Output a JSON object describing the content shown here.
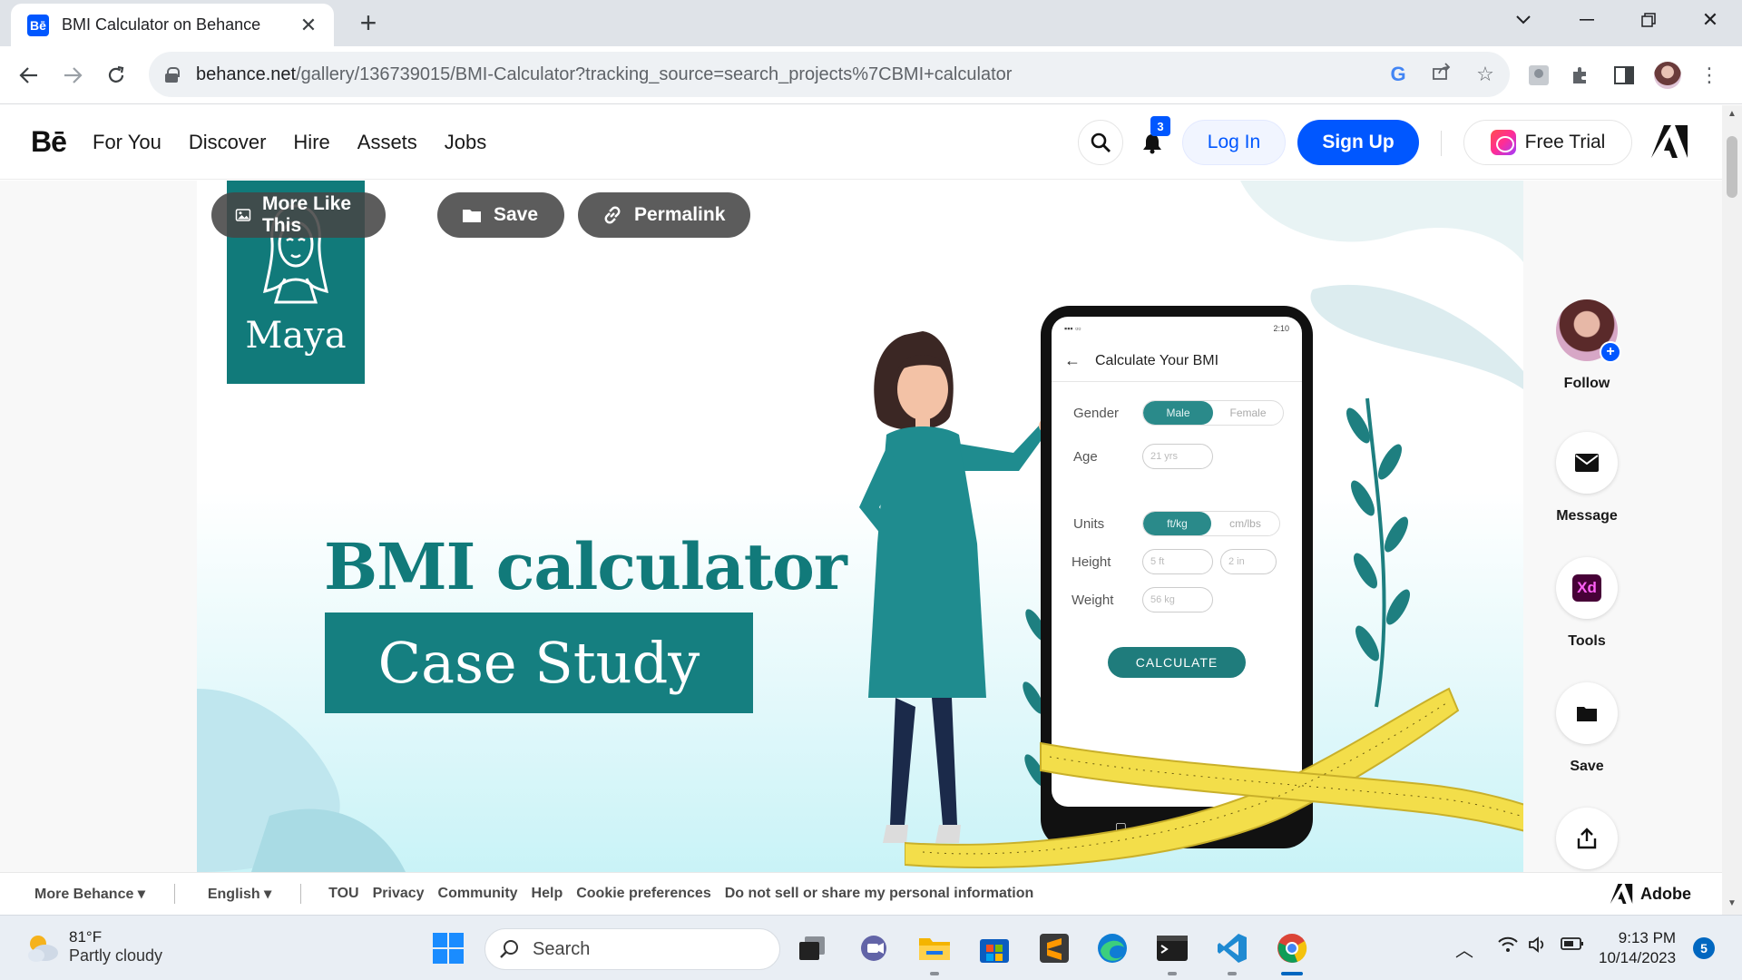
{
  "browser": {
    "tab_title": "BMI Calculator on Behance",
    "tab_favicon": "Bē",
    "url_host": "behance.net",
    "url_path": "/gallery/136739015/BMI-Calculator?tracking_source=search_projects%7CBMI+calculator"
  },
  "header": {
    "logo": "Bē",
    "nav": [
      "For You",
      "Discover",
      "Hire",
      "Assets",
      "Jobs"
    ],
    "notification_count": "3",
    "login_label": "Log In",
    "signup_label": "Sign Up",
    "trial_label": "Free Trial"
  },
  "project": {
    "actions": {
      "more_like_this": "More Like This",
      "save": "Save",
      "permalink": "Permalink"
    },
    "brand_name": "Maya",
    "title_line1": "BMI calculator",
    "title_line2": "Case Study",
    "phone": {
      "status": "2:10",
      "screen_title": "Calculate Your BMI",
      "gender_label": "Gender",
      "gender_options": [
        "Male",
        "Female"
      ],
      "age_label": "Age",
      "age_placeholder": "21 yrs",
      "units_label": "Units",
      "units_options": [
        "ft/kg",
        "cm/lbs"
      ],
      "height_label": "Height",
      "height_ft": "5 ft",
      "height_in": "2 in",
      "weight_label": "Weight",
      "weight_placeholder": "56 kg",
      "button": "CALCULATE"
    }
  },
  "rail": {
    "follow": "Follow",
    "message": "Message",
    "tools": "Tools",
    "tools_app": "Xd",
    "save": "Save"
  },
  "footer": {
    "more_behance": "More Behance",
    "language": "English",
    "links": [
      "TOU",
      "Privacy",
      "Community",
      "Help",
      "Cookie preferences",
      "Do not sell or share my personal information"
    ],
    "adobe": "Adobe"
  },
  "taskbar": {
    "temperature": "81°F",
    "weather": "Partly cloudy",
    "search_placeholder": "Search",
    "time": "9:13 PM",
    "date": "10/14/2023",
    "notifications": "5"
  },
  "colors": {
    "behance_blue": "#0057ff",
    "teal": "#117a7a",
    "teal_band": "#157f80"
  }
}
